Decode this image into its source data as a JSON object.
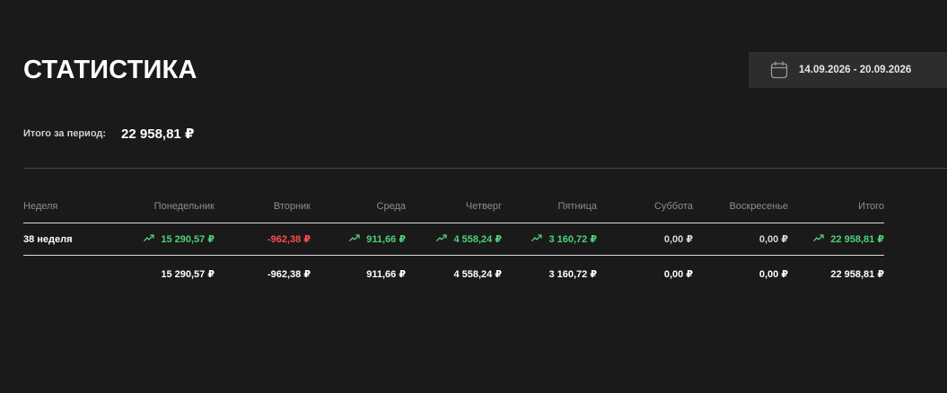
{
  "page": {
    "title": "СТАТИСТИКА"
  },
  "date_range": {
    "icon": "calendar-icon",
    "text": "14.09.2026 - 20.09.2026"
  },
  "summary": {
    "label": "Итого за период:",
    "value": "22 958,81 ₽"
  },
  "colors": {
    "background": "#1a1a1a",
    "date_button_bg": "#2d2d2d",
    "positive": "#4fd07a",
    "negative": "#ff4d4d"
  },
  "table": {
    "headers": [
      "Неделя",
      "Понедельник",
      "Вторник",
      "Среда",
      "Четверг",
      "Пятница",
      "Суббота",
      "Воскресенье",
      "Итого"
    ],
    "rows": [
      {
        "week": "38 неделя",
        "cells": [
          {
            "value": "15 290,57 ₽",
            "trend": "up"
          },
          {
            "value": "-962,38 ₽",
            "trend": "down"
          },
          {
            "value": "911,66 ₽",
            "trend": "up"
          },
          {
            "value": "4 558,24 ₽",
            "trend": "up"
          },
          {
            "value": "3 160,72 ₽",
            "trend": "up"
          },
          {
            "value": "0,00 ₽",
            "trend": "none"
          },
          {
            "value": "0,00 ₽",
            "trend": "none"
          },
          {
            "value": "22 958,81 ₽",
            "trend": "up"
          }
        ]
      }
    ],
    "totals": [
      "15 290,57 ₽",
      "-962,38 ₽",
      "911,66 ₽",
      "4 558,24 ₽",
      "3 160,72 ₽",
      "0,00 ₽",
      "0,00 ₽",
      "22 958,81 ₽"
    ]
  }
}
